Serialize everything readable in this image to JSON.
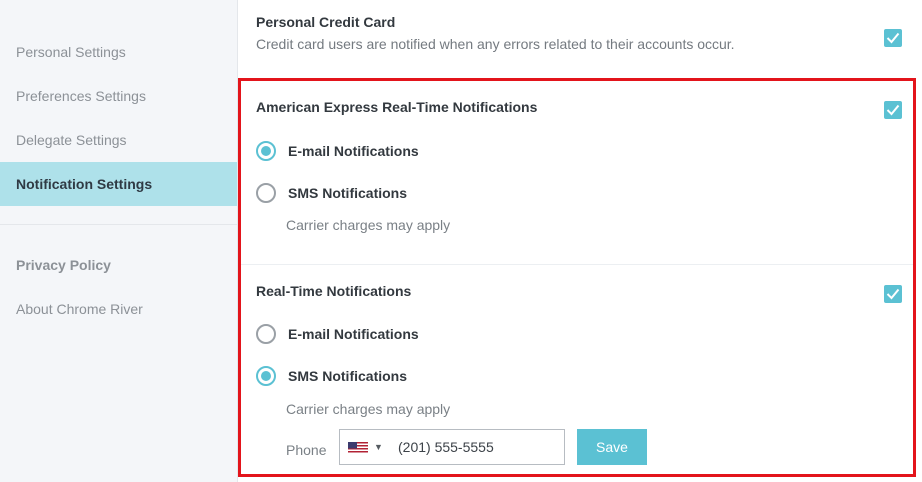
{
  "sidebar": {
    "items": [
      {
        "label": "Personal Settings"
      },
      {
        "label": "Preferences Settings"
      },
      {
        "label": "Delegate Settings"
      },
      {
        "label": "Notification Settings"
      }
    ],
    "secondary": [
      {
        "label": "Privacy Policy"
      },
      {
        "label": "About Chrome River"
      }
    ]
  },
  "personal_card": {
    "title": "Personal Credit Card",
    "description": "Credit card users are notified when any errors related to their accounts occur.",
    "checked": true
  },
  "amex": {
    "title": "American Express Real-Time Notifications",
    "checked": true,
    "email_label": "E-mail Notifications",
    "sms_label": "SMS Notifications",
    "selected": "email",
    "carrier_note": "Carrier charges may apply"
  },
  "realtime": {
    "title": "Real-Time Notifications",
    "checked": true,
    "email_label": "E-mail Notifications",
    "sms_label": "SMS Notifications",
    "selected": "sms",
    "carrier_note": "Carrier charges may apply",
    "phone_label": "Phone",
    "phone_value": "(201) 555-5555",
    "country_icon": "us-flag-icon",
    "save_label": "Save"
  },
  "colors": {
    "accent": "#5bc1d3",
    "active_nav": "#aee1ea",
    "highlight_border": "#e3141b"
  }
}
